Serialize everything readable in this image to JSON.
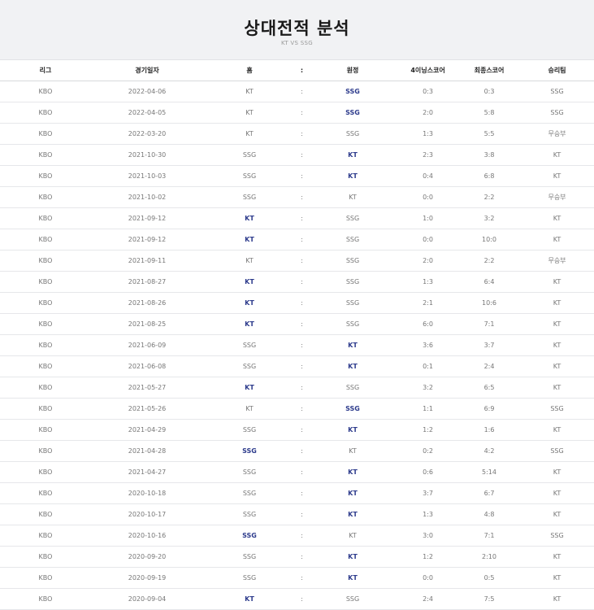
{
  "header": {
    "title": "상대전적 분석",
    "subtitle": "KT VS SSG"
  },
  "table": {
    "headers": [
      "리그",
      "경기일자",
      "홈",
      ":",
      "원정",
      "4이닝스코어",
      "최종스코어",
      "승리팀"
    ],
    "rows": [
      [
        "KBO",
        "2022-04-06",
        "KT",
        ":",
        "SSG",
        "0:3",
        "0:3",
        "SSG"
      ],
      [
        "KBO",
        "2022-04-05",
        "KT",
        ":",
        "SSG",
        "2:0",
        "5:8",
        "SSG"
      ],
      [
        "KBO",
        "2022-03-20",
        "KT",
        ":",
        "SSG",
        "1:3",
        "5:5",
        "무승부"
      ],
      [
        "KBO",
        "2021-10-30",
        "SSG",
        ":",
        "KT",
        "2:3",
        "3:8",
        "KT"
      ],
      [
        "KBO",
        "2021-10-03",
        "SSG",
        ":",
        "KT",
        "0:4",
        "6:8",
        "KT"
      ],
      [
        "KBO",
        "2021-10-02",
        "SSG",
        ":",
        "KT",
        "0:0",
        "2:2",
        "무승부"
      ],
      [
        "KBO",
        "2021-09-12",
        "KT",
        ":",
        "SSG",
        "1:0",
        "3:2",
        "KT"
      ],
      [
        "KBO",
        "2021-09-12",
        "KT",
        ":",
        "SSG",
        "0:0",
        "10:0",
        "KT"
      ],
      [
        "KBO",
        "2021-09-11",
        "KT",
        ":",
        "SSG",
        "2:0",
        "2:2",
        "무승부"
      ],
      [
        "KBO",
        "2021-08-27",
        "KT",
        ":",
        "SSG",
        "1:3",
        "6:4",
        "KT"
      ],
      [
        "KBO",
        "2021-08-26",
        "KT",
        ":",
        "SSG",
        "2:1",
        "10:6",
        "KT"
      ],
      [
        "KBO",
        "2021-08-25",
        "KT",
        ":",
        "SSG",
        "6:0",
        "7:1",
        "KT"
      ],
      [
        "KBO",
        "2021-06-09",
        "SSG",
        ":",
        "KT",
        "3:6",
        "3:7",
        "KT"
      ],
      [
        "KBO",
        "2021-06-08",
        "SSG",
        ":",
        "KT",
        "0:1",
        "2:4",
        "KT"
      ],
      [
        "KBO",
        "2021-05-27",
        "KT",
        ":",
        "SSG",
        "3:2",
        "6:5",
        "KT"
      ],
      [
        "KBO",
        "2021-05-26",
        "KT",
        ":",
        "SSG",
        "1:1",
        "6:9",
        "SSG"
      ],
      [
        "KBO",
        "2021-04-29",
        "SSG",
        ":",
        "KT",
        "1:2",
        "1:6",
        "KT"
      ],
      [
        "KBO",
        "2021-04-28",
        "SSG",
        ":",
        "KT",
        "0:2",
        "4:2",
        "SSG"
      ],
      [
        "KBO",
        "2021-04-27",
        "SSG",
        ":",
        "KT",
        "0:6",
        "5:14",
        "KT"
      ],
      [
        "KBO",
        "2020-10-18",
        "SSG",
        ":",
        "KT",
        "3:7",
        "6:7",
        "KT"
      ],
      [
        "KBO",
        "2020-10-17",
        "SSG",
        ":",
        "KT",
        "1:3",
        "4:8",
        "KT"
      ],
      [
        "KBO",
        "2020-10-16",
        "SSG",
        ":",
        "KT",
        "3:0",
        "7:1",
        "SSG"
      ],
      [
        "KBO",
        "2020-09-20",
        "SSG",
        ":",
        "KT",
        "1:2",
        "2:10",
        "KT"
      ],
      [
        "KBO",
        "2020-09-19",
        "SSG",
        ":",
        "KT",
        "0:0",
        "0:5",
        "KT"
      ],
      [
        "KBO",
        "2020-09-04",
        "KT",
        ":",
        "SSG",
        "2:4",
        "7:5",
        "KT"
      ]
    ]
  }
}
